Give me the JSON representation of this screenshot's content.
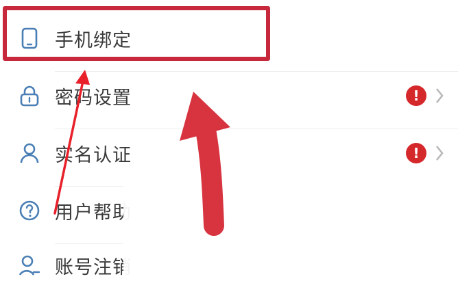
{
  "menu": {
    "items": [
      {
        "label": "手机绑定",
        "icon": "phone-icon",
        "badge": ""
      },
      {
        "label": "密码设置",
        "icon": "lock-icon",
        "badge": "!"
      },
      {
        "label": "实名认证",
        "icon": "person-icon",
        "badge": "!"
      },
      {
        "label": "用户帮助",
        "icon": "help-icon",
        "badge": ""
      },
      {
        "label": "账号注销",
        "icon": "user-remove-icon",
        "badge": ""
      }
    ]
  },
  "colors": {
    "annotation_red": "#c8283c",
    "badge_red": "#d5282b",
    "icon_blue": "#4a7fb5",
    "chevron_gray": "#b8b8b8"
  }
}
